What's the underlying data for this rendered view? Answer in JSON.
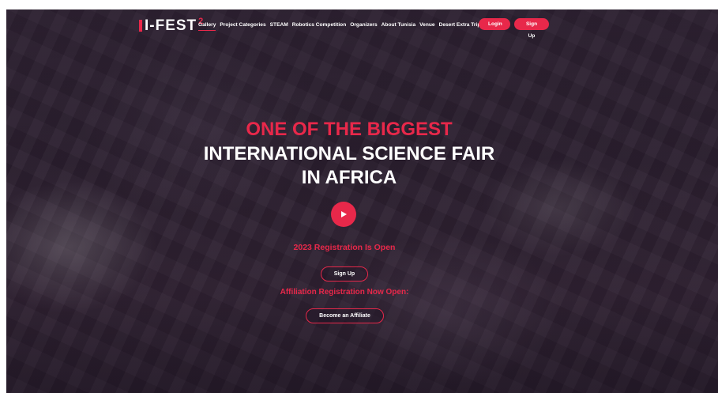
{
  "header": {
    "logo_text": "I-FEST",
    "logo_superscript": "2",
    "nav": [
      {
        "label": "Gallery"
      },
      {
        "label": "Project Categories"
      },
      {
        "label": "STEAM"
      },
      {
        "label": "Robotics Competition"
      },
      {
        "label": "Organizers"
      },
      {
        "label": "About Tunisia"
      },
      {
        "label": "Venue"
      },
      {
        "label": "Desert Extra Trip"
      }
    ],
    "login_label": "Login",
    "signup_label": "Sign Up"
  },
  "hero": {
    "headline_line1": "ONE OF THE BIGGEST",
    "headline_line2": "INTERNATIONAL SCIENCE FAIR",
    "headline_line3": "IN AFRICA",
    "registration_text": "2023 Registration Is Open",
    "signup_button": "Sign Up",
    "affiliation_text": "Affiliation Registration Now Open:",
    "affiliate_button": "Become an Affiliate"
  },
  "colors": {
    "accent": "#e8284a",
    "text": "#ffffff",
    "overlay": "#2a1e2e"
  },
  "icons": {
    "play": "play-icon"
  }
}
